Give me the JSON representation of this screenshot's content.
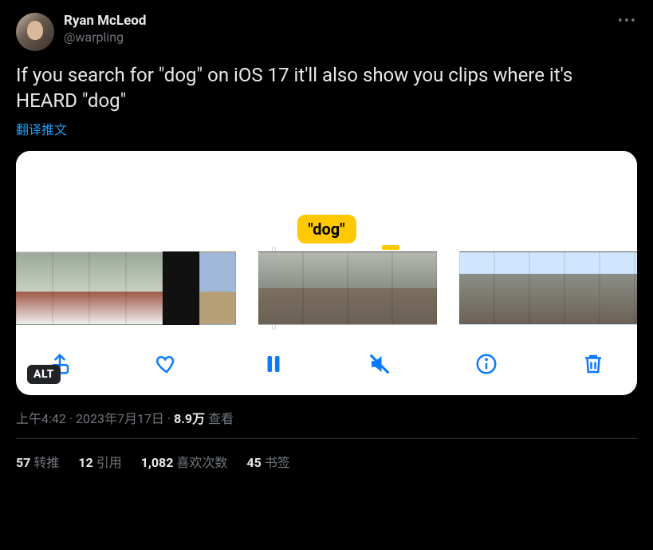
{
  "author": {
    "display_name": "Ryan McLeod",
    "handle": "@warpling"
  },
  "tweet_text": "If you search for \"dog\" on iOS 17 it'll also show you clips where it's HEARD \"dog\"",
  "translate_label": "翻译推文",
  "media": {
    "tooltip_text": "\"dog\"",
    "alt_badge": "ALT",
    "toolbar_icons": {
      "share": "share-icon",
      "like": "heart-icon",
      "pause": "pause-icon",
      "mute": "speaker-muted-icon",
      "info": "info-icon",
      "trash": "trash-icon"
    }
  },
  "meta": {
    "time": "上午4:42",
    "dot": " · ",
    "date": "2023年7月17日",
    "views_number": "8.9万",
    "views_label": " 查看"
  },
  "stats": {
    "retweets": {
      "count": "57",
      "label": "转推"
    },
    "quotes": {
      "count": "12",
      "label": "引用"
    },
    "likes": {
      "count": "1,082",
      "label": "喜欢次数"
    },
    "bookmarks": {
      "count": "45",
      "label": "书签"
    }
  },
  "more_icon": "•••"
}
